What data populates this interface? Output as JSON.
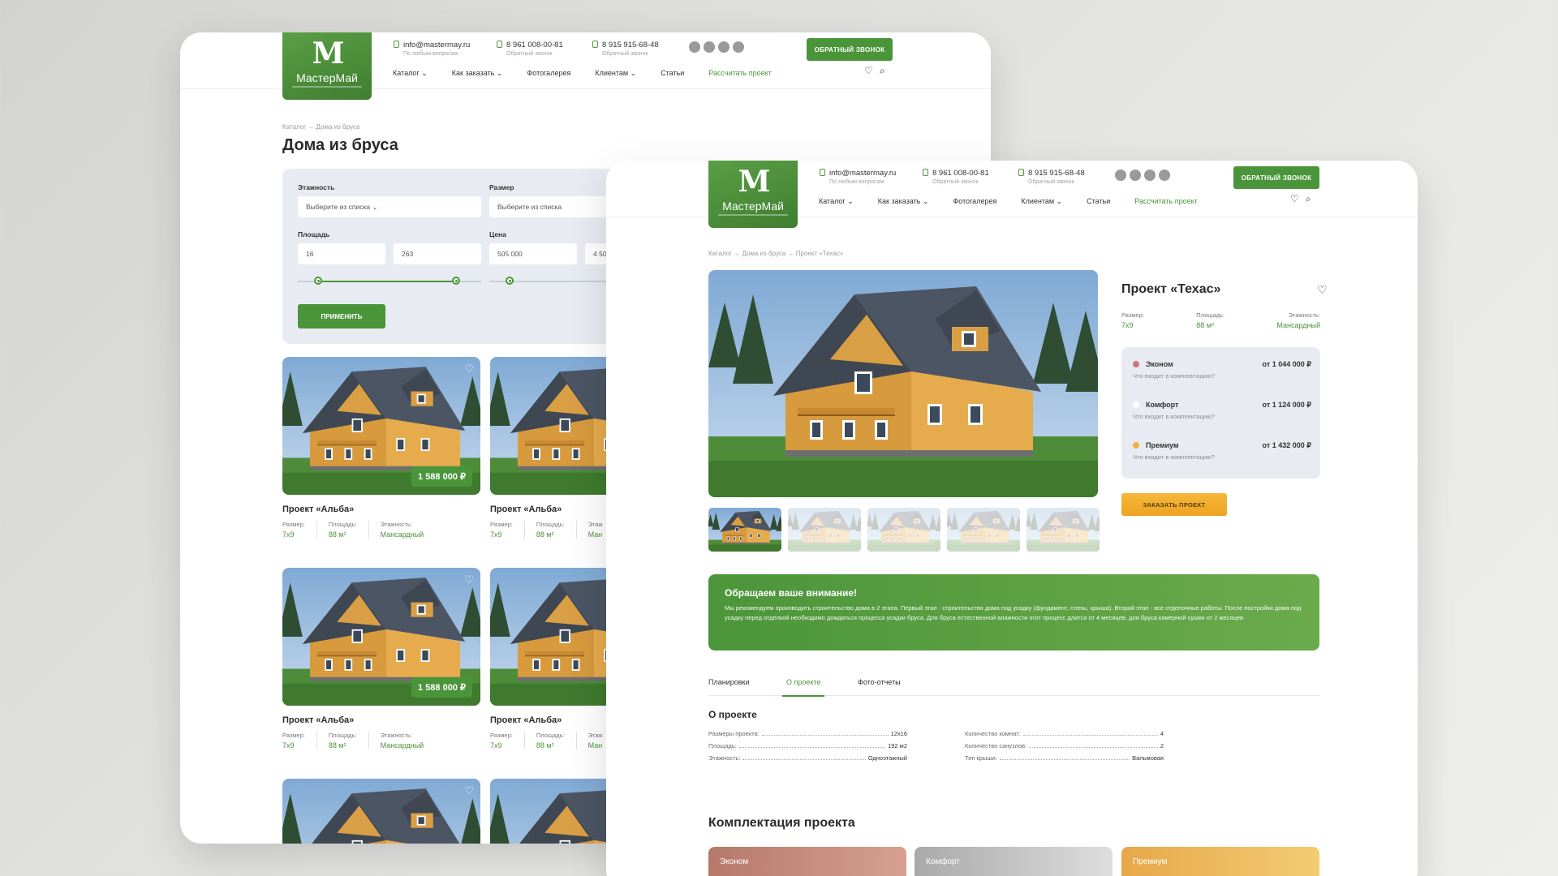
{
  "brand": {
    "name": "МастерМай",
    "mark": "M"
  },
  "header": {
    "email": "info@mastermay.ru",
    "email_note": "По любым вопросам",
    "phone1": "8 961 008-00-81",
    "phone1_note": "Обратный звонок",
    "phone2": "8 915 915-68-48",
    "phone2_note": "Обратный звонок",
    "callback": "ОБРАТНЫЙ ЗВОНОК",
    "nav": [
      "Каталог ⌄",
      "Как заказать ⌄",
      "Фотогалерея",
      "Клиентам ⌄",
      "Статьи",
      "Рассчитать проект"
    ],
    "heart_icon": "♡",
    "search_icon": "⌕"
  },
  "catalog": {
    "crumb": "Каталог → Дома из бруса",
    "title": "Дома из бруса",
    "filters": {
      "floors_label": "Этажность",
      "floors_placeholder": "Выберите из списка ⌄",
      "size_label": "Размер",
      "size_placeholder": "Выберите из списка",
      "area_label": "Площадь",
      "area_min": "16",
      "area_max": "263",
      "price_label": "Цена",
      "price_min": "505 000",
      "price_max": "4 50",
      "apply": "ПРИМЕНИТЬ"
    },
    "cards": [
      {
        "name": "Проект «Альба»",
        "price": "1 588 000 ₽",
        "size_l": "Размер:",
        "size": "7x9",
        "area_l": "Площадь:",
        "area": "88 м²",
        "floors_l": "Этажность:",
        "floors": "Мансардный"
      },
      {
        "name": "Проект «Альба»",
        "price": "",
        "size_l": "Размер:",
        "size": "7x9",
        "area_l": "Площадь:",
        "area": "88 м²",
        "floors_l": "Этаж",
        "floors": "Ман"
      },
      {
        "name": "Проект «Альба»",
        "price": "1 588 000 ₽",
        "size_l": "Размер:",
        "size": "7x9",
        "area_l": "Площадь:",
        "area": "88 м²",
        "floors_l": "Этажность:",
        "floors": "Мансардный"
      },
      {
        "name": "Проект «Альба»",
        "price": "",
        "size_l": "Размер:",
        "size": "7x9",
        "area_l": "Площадь:",
        "area": "88 м²",
        "floors_l": "Этаж",
        "floors": "Ман"
      }
    ]
  },
  "product": {
    "crumb": "Каталог → Дома из бруса → Проект «Техас»",
    "title": "Проект «Техас»",
    "size_l": "Размер:",
    "size": "7x9",
    "area_l": "Площадь:",
    "area": "88 м²",
    "floors_l": "Этажность:",
    "floors": "Мансардный",
    "packages": [
      {
        "name": "Эконом",
        "price": "от 1 044 000 ₽",
        "note": "Что входит в комплектацию?",
        "color": "#c9777a"
      },
      {
        "name": "Комфорт",
        "price": "от 1 124 000 ₽",
        "note": "Что входит в комплектацию?",
        "color": "#ffffff"
      },
      {
        "name": "Премиум",
        "price": "от 1 432 000 ₽",
        "note": "Что входит в комплектацию?",
        "color": "#f0b13a"
      }
    ],
    "order": "ЗАКАЗАТЬ ПРОЕКТ",
    "notice_title": "Обращаем ваше внимание!",
    "notice_text": "Мы рекомендуем производить строительство дома в 2 этапа. Первый этап - строительство дома под усадку (фундамент, стены, крыша). Второй этап - все отделочные работы. После постройки дома под усадку перед отделкой необходимо дождаться процесса усадки бруса. Для бруса естественной влажности этот процесс длится от 4 месяцев, для бруса камерной сушки от 2 месяцев.",
    "tabs": [
      "Планировки",
      "О проекте",
      "Фото-отчеты"
    ],
    "about_title": "О проекте",
    "about_left": [
      [
        "Размеры проекта:",
        "12x16"
      ],
      [
        "Площадь:",
        "192 м2"
      ],
      [
        "Этажность:",
        "Одноэтажный"
      ]
    ],
    "about_right": [
      [
        "Количество комнат:",
        "4"
      ],
      [
        "Количество санузлов:",
        "2"
      ],
      [
        "Тип крыши:",
        "Вальмовая"
      ]
    ],
    "komp_title": "Комплектация проекта",
    "komp": [
      "Эконом",
      "Комфорт",
      "Премиум"
    ]
  },
  "colors": {
    "brand_green": "#4a953a",
    "accent_orange": "#f0a62a",
    "filter_bg": "#e8ecf2"
  }
}
